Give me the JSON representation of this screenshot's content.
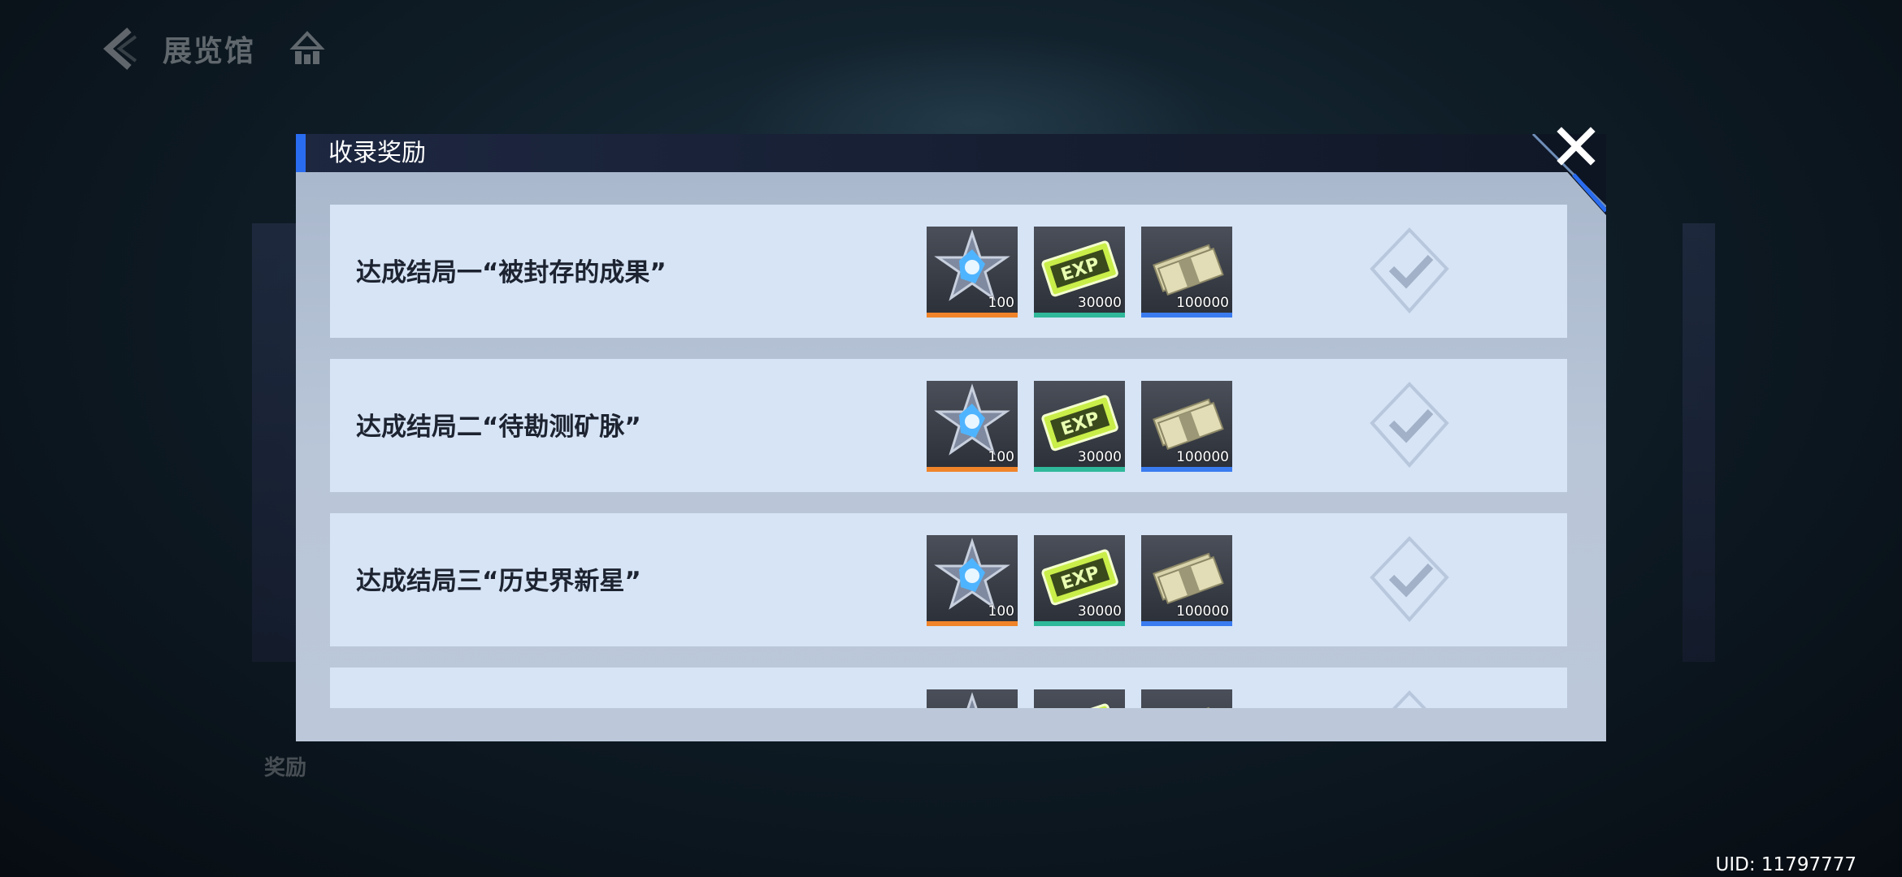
{
  "nav": {
    "title": "展览馆"
  },
  "modal": {
    "title": "收录奖励",
    "rows": [
      {
        "label": "达成结局一“被封存的成果”",
        "rewards": [
          "100",
          "30000",
          "100000"
        ]
      },
      {
        "label": "达成结局二“待勘测矿脉”",
        "rewards": [
          "100",
          "30000",
          "100000"
        ]
      },
      {
        "label": "达成结局三“历史界新星”",
        "rewards": [
          "100",
          "30000",
          "100000"
        ]
      },
      {
        "label": "",
        "rewards": [
          "",
          "",
          ""
        ]
      }
    ],
    "reward_icons": [
      "star-crystal-icon",
      "exp-card-icon",
      "cash-bundle-icon"
    ],
    "reward_bar_colors": [
      "#f0842a",
      "#2fb89a",
      "#3a7bf0"
    ]
  },
  "background": {
    "side_label": "奖励"
  },
  "uid": "UID: 11797777"
}
